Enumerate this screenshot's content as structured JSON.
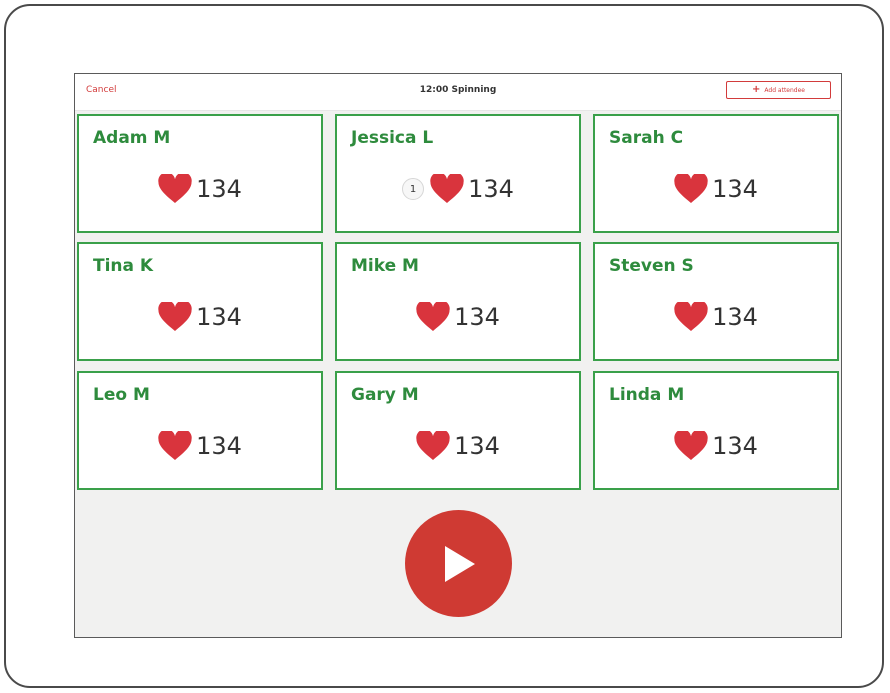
{
  "topbar": {
    "cancel_label": "Cancel",
    "title": "12:00 Spinning",
    "add_label": "Add attendee"
  },
  "colors": {
    "accent_red": "#cf3a33",
    "card_green": "#3aa04a",
    "name_green": "#2e8b3d",
    "heart_red": "#d9343d"
  },
  "attendees": [
    {
      "name": "Adam M",
      "heart_rate": "134",
      "badge": ""
    },
    {
      "name": "Jessica L",
      "heart_rate": "134",
      "badge": "1"
    },
    {
      "name": "Sarah C",
      "heart_rate": "134",
      "badge": ""
    },
    {
      "name": "Tina K",
      "heart_rate": "134",
      "badge": ""
    },
    {
      "name": "Mike M",
      "heart_rate": "134",
      "badge": ""
    },
    {
      "name": "Steven S",
      "heart_rate": "134",
      "badge": ""
    },
    {
      "name": "Leo M",
      "heart_rate": "134",
      "badge": ""
    },
    {
      "name": "Gary M",
      "heart_rate": "134",
      "badge": ""
    },
    {
      "name": "Linda M",
      "heart_rate": "134",
      "badge": ""
    }
  ],
  "icons": {
    "heart": "heart-icon",
    "play": "play-icon",
    "add": "plus-icon"
  }
}
